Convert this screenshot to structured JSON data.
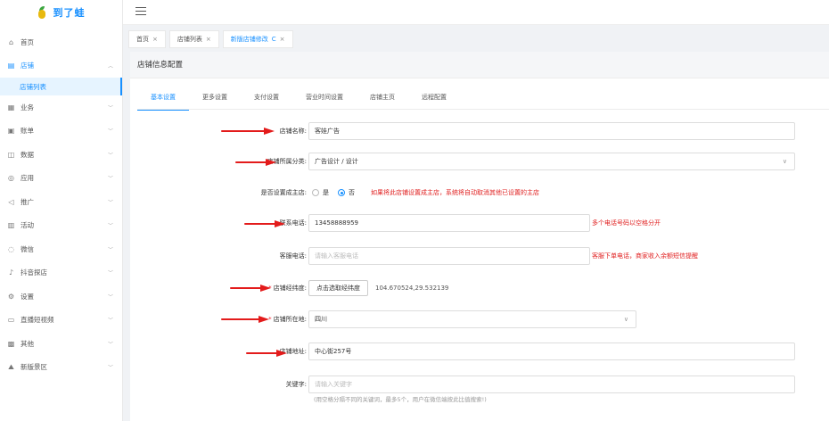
{
  "app": {
    "logo_text": "到了蛙"
  },
  "sidebar": {
    "items": [
      {
        "label": "首页",
        "icon": "home-icon",
        "glyph": "⌂",
        "arrow": false
      },
      {
        "label": "店铺",
        "icon": "store-icon",
        "glyph": "▤",
        "arrow": true,
        "arrow_glyph": "︿",
        "active": true
      },
      {
        "label": "业务",
        "icon": "business-icon",
        "glyph": "▦",
        "arrow": true,
        "arrow_glyph": "﹀"
      },
      {
        "label": "账单",
        "icon": "bill-icon",
        "glyph": "▣",
        "arrow": true,
        "arrow_glyph": "﹀"
      },
      {
        "label": "数据",
        "icon": "data-icon",
        "glyph": "◫",
        "arrow": true,
        "arrow_glyph": "﹀"
      },
      {
        "label": "应用",
        "icon": "app-icon",
        "glyph": "◎",
        "arrow": true,
        "arrow_glyph": "﹀"
      },
      {
        "label": "推广",
        "icon": "promote-icon",
        "glyph": "◁",
        "arrow": true,
        "arrow_glyph": "﹀"
      },
      {
        "label": "活动",
        "icon": "activity-icon",
        "glyph": "▥",
        "arrow": true,
        "arrow_glyph": "﹀"
      },
      {
        "label": "微信",
        "icon": "wechat-icon",
        "glyph": "◌",
        "arrow": true,
        "arrow_glyph": "﹀"
      },
      {
        "label": "抖音探店",
        "icon": "douyin-icon",
        "glyph": "♪",
        "arrow": true,
        "arrow_glyph": "﹀"
      },
      {
        "label": "设置",
        "icon": "settings-icon",
        "glyph": "⚙",
        "arrow": true,
        "arrow_glyph": "﹀"
      },
      {
        "label": "直播短视频",
        "icon": "live-icon",
        "glyph": "▭",
        "arrow": true,
        "arrow_glyph": "﹀"
      },
      {
        "label": "其他",
        "icon": "other-icon",
        "glyph": "▩",
        "arrow": true,
        "arrow_glyph": "﹀"
      },
      {
        "label": "新版景区",
        "icon": "scenic-icon",
        "glyph": "⛰",
        "arrow": true,
        "arrow_glyph": "﹀"
      }
    ],
    "sub_item": "店铺列表"
  },
  "tabs": [
    {
      "label": "首页",
      "close": "×",
      "active": false
    },
    {
      "label": "店铺列表",
      "close": "×",
      "active": false
    },
    {
      "label": "新版店铺修改",
      "refresh": "C",
      "close": "×",
      "active": true
    }
  ],
  "card": {
    "title": "店铺信息配置"
  },
  "subtabs": [
    "基本设置",
    "更多设置",
    "支付设置",
    "营业时间设置",
    "店铺主页",
    "远程配置"
  ],
  "form": {
    "shop_name": {
      "label": "店铺名称:",
      "value": "客娃广告"
    },
    "category": {
      "label": "店铺所属分类:",
      "value": "广告设计 / 设计"
    },
    "main_shop": {
      "label": "是否设置成主店:",
      "yes": "是",
      "no": "否",
      "selected": "否",
      "hint": "如果将此店铺设置成主店，系统将自动取消其他已设置的主店"
    },
    "phone": {
      "label": "联系电话:",
      "value": "13458888959",
      "hint": "多个电话号码以空格分开"
    },
    "service_phone": {
      "label": "客服电话:",
      "placeholder": "请输入客服电话",
      "hint": "客服下单电话，商家收入余额短信提醒"
    },
    "coords": {
      "label": "店铺经纬度:",
      "button": "点击选取经纬度",
      "value": "104.670524,29.532139"
    },
    "location": {
      "label": "店铺所在地:",
      "value": "四川"
    },
    "address": {
      "label": "店铺地址:",
      "value": "中心街257号"
    },
    "keywords": {
      "label": "关键字:",
      "placeholder": "请输入关键字",
      "hint": "(用空格分隔不同的关键词，最多5个，用户在微信端按此比值搜索!)"
    }
  },
  "colors": {
    "accent": "#1890ff",
    "annotation_red": "#e31b1b",
    "hint_red": "#e02020"
  }
}
